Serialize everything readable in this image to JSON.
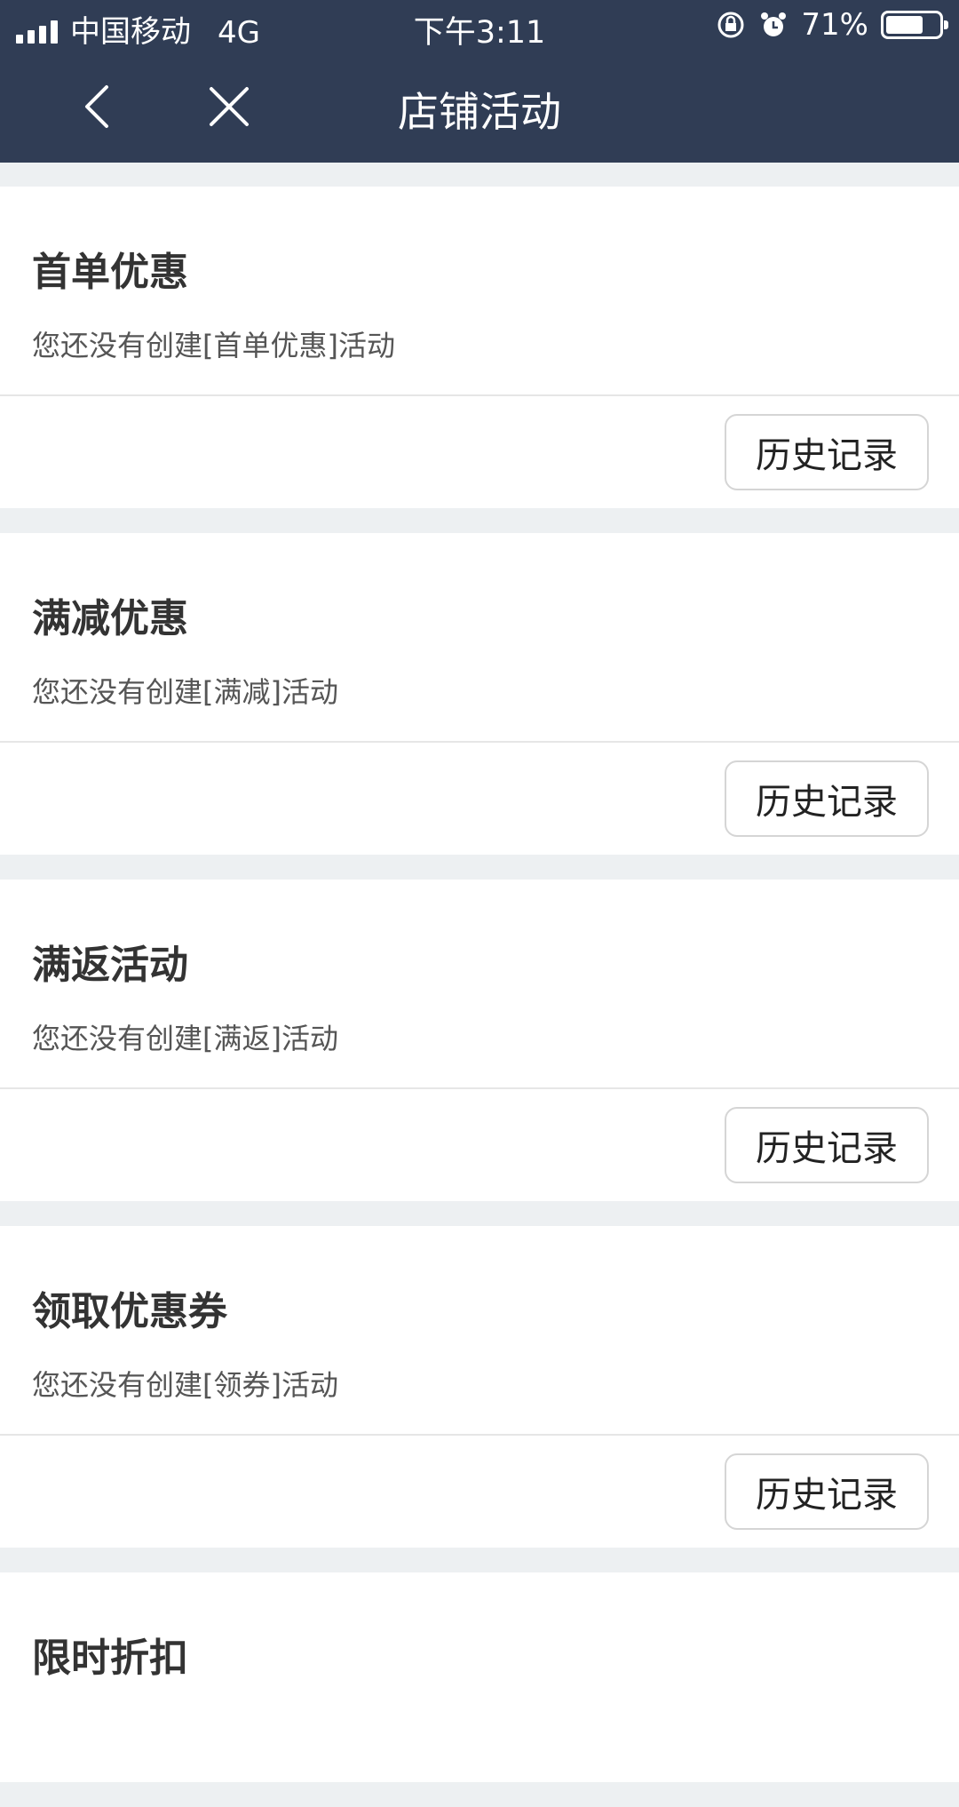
{
  "status_bar": {
    "carrier": "中国移动",
    "network": "4G",
    "time": "下午3:11",
    "battery": "71%",
    "battery_level": 0.71
  },
  "nav": {
    "title": "店铺活动",
    "back_icon": "chevron-left-icon",
    "close_icon": "close-icon"
  },
  "activities": [
    {
      "title": "首单优惠",
      "desc": "您还没有创建[首单优惠]活动",
      "button": "历史记录"
    },
    {
      "title": "满减优惠",
      "desc": "您还没有创建[满减]活动",
      "button": "历史记录"
    },
    {
      "title": "满返活动",
      "desc": "您还没有创建[满返]活动",
      "button": "历史记录"
    },
    {
      "title": "领取优惠券",
      "desc": "您还没有创建[领券]活动",
      "button": "历史记录"
    },
    {
      "title": "限时折扣"
    }
  ],
  "colors": {
    "topbar": "#303d55",
    "background": "#edf0f2"
  }
}
